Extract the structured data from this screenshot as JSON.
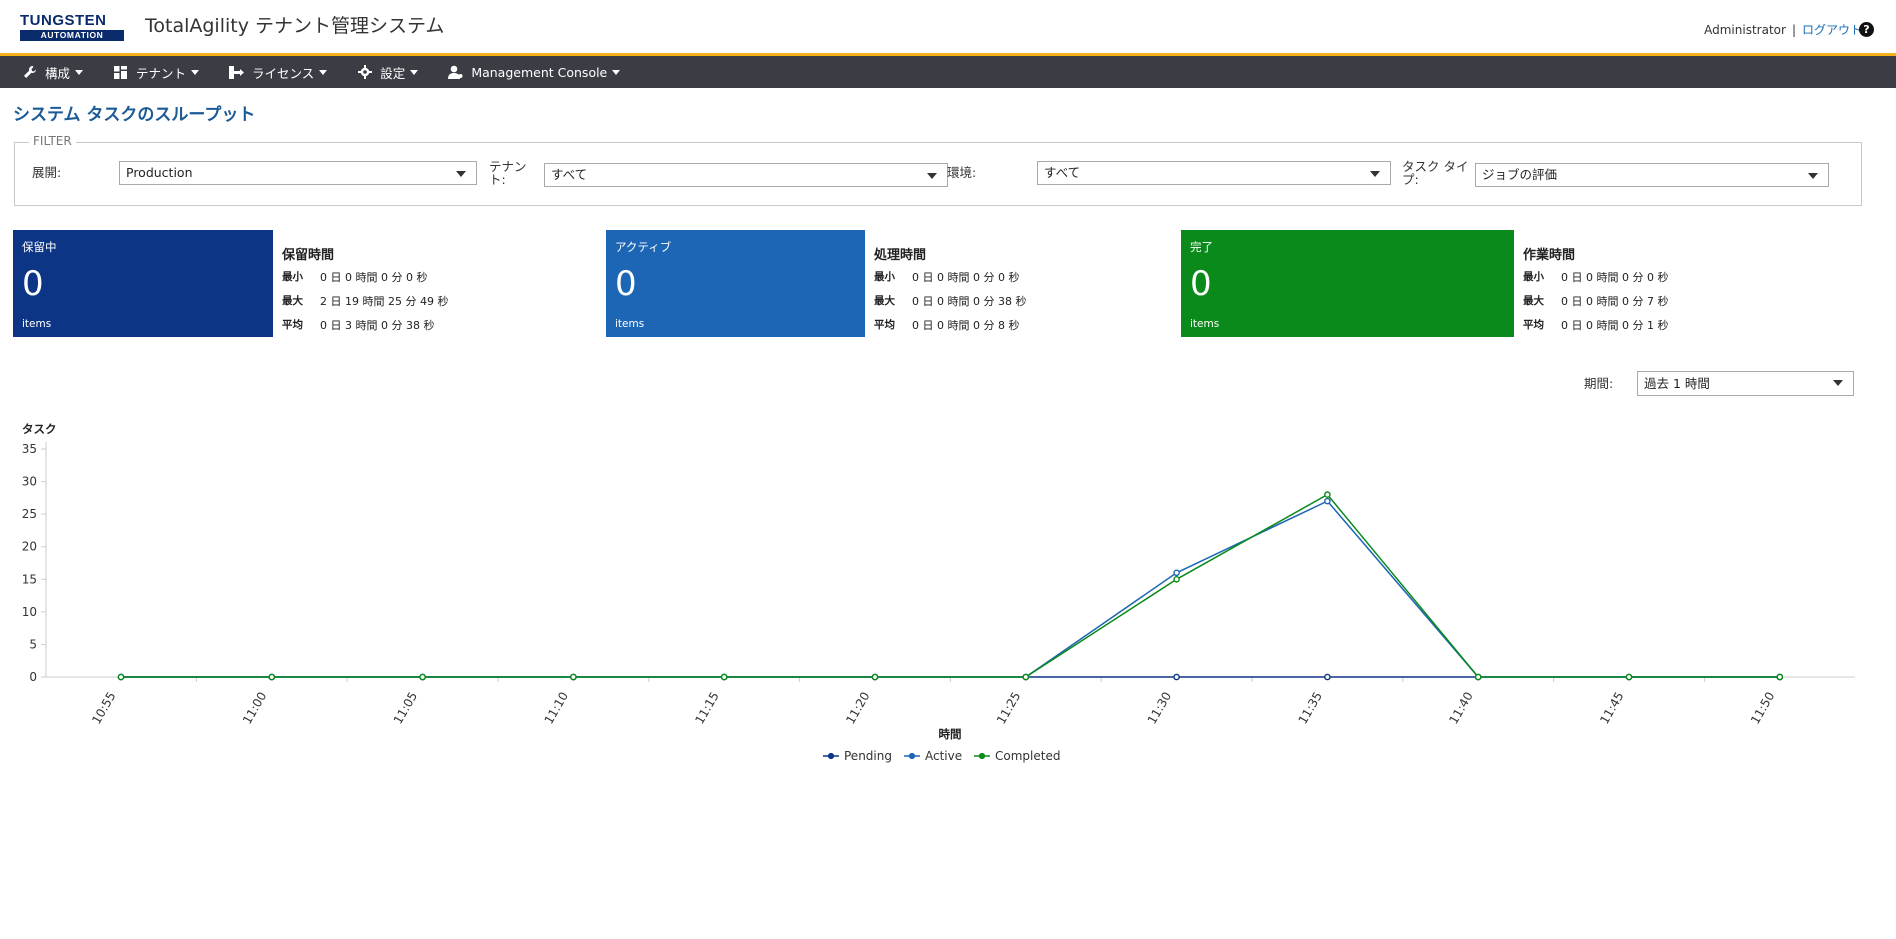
{
  "header": {
    "logo_line1": "TUNGSTEN",
    "logo_line2": "AUTOMATION",
    "app_title": "TotalAgility テナント管理システム",
    "user": "Administrator",
    "separator": "|",
    "logout": "ログアウト",
    "help": "?"
  },
  "nav": {
    "items": [
      {
        "label": "構成",
        "icon": "wrench-icon"
      },
      {
        "label": "テナント",
        "icon": "dashboard-icon"
      },
      {
        "label": "ライセンス",
        "icon": "license-icon"
      },
      {
        "label": "設定",
        "icon": "gear-icon"
      },
      {
        "label": "Management Console",
        "icon": "user-gear-icon"
      }
    ]
  },
  "page": {
    "title": "システム タスクのスループット"
  },
  "filter": {
    "legend": "FILTER",
    "deployment_label": "展開:",
    "deployment_value": "Production",
    "tenant_label_1": "テナン",
    "tenant_label_2": "ト:",
    "tenant_value": "すべて",
    "environment_label": "環境:",
    "environment_value": "すべて",
    "tasktype_label_1": "タスク タイ",
    "tasktype_label_2": "プ:",
    "tasktype_value": "ジョブの評価"
  },
  "tiles": [
    {
      "label": "保留中",
      "count": "0",
      "items": "items",
      "color": "#0d3585"
    },
    {
      "label": "アクティブ",
      "count": "0",
      "items": "items",
      "color": "#1c66b5"
    },
    {
      "label": "完了",
      "count": "0",
      "items": "items",
      "color": "#098a1a"
    }
  ],
  "stats": [
    {
      "title": "保留時間",
      "rows": [
        {
          "k": "最小",
          "v": "0 日 0 時間 0 分 0 秒"
        },
        {
          "k": "最大",
          "v": "2 日 19 時間 25 分 49 秒"
        },
        {
          "k": "平均",
          "v": "0 日 3 時間 0 分 38 秒"
        }
      ]
    },
    {
      "title": "処理時間",
      "rows": [
        {
          "k": "最小",
          "v": "0 日 0 時間 0 分 0 秒"
        },
        {
          "k": "最大",
          "v": "0 日 0 時間 0 分 38 秒"
        },
        {
          "k": "平均",
          "v": "0 日 0 時間 0 分 8 秒"
        }
      ]
    },
    {
      "title": "作業時間",
      "rows": [
        {
          "k": "最小",
          "v": "0 日 0 時間 0 分 0 秒"
        },
        {
          "k": "最大",
          "v": "0 日 0 時間 0 分 7 秒"
        },
        {
          "k": "平均",
          "v": "0 日 0 時間 0 分 1 秒"
        }
      ]
    }
  ],
  "period": {
    "label": "期間:",
    "value": "過去 1 時間"
  },
  "chart_data": {
    "type": "line",
    "ylabel": "タスク",
    "xlabel": "時間",
    "ylim": [
      0,
      35
    ],
    "yticks": [
      0,
      5,
      10,
      15,
      20,
      25,
      30,
      35
    ],
    "categories": [
      "10:55",
      "11:00",
      "11:05",
      "11:10",
      "11:15",
      "11:20",
      "11:25",
      "11:30",
      "11:35",
      "11:40",
      "11:45",
      "11:50"
    ],
    "series": [
      {
        "name": "Pending",
        "color": "#0d3585",
        "values": [
          0,
          0,
          0,
          0,
          0,
          0,
          0,
          0,
          0,
          0,
          0,
          0
        ]
      },
      {
        "name": "Active",
        "color": "#1c66b5",
        "values": [
          0,
          0,
          0,
          0,
          0,
          0,
          0,
          16,
          27,
          0,
          0,
          0
        ]
      },
      {
        "name": "Completed",
        "color": "#098a1a",
        "values": [
          0,
          0,
          0,
          0,
          0,
          0,
          0,
          15,
          28,
          0,
          0,
          0
        ]
      }
    ],
    "legend_position": "bottom"
  }
}
